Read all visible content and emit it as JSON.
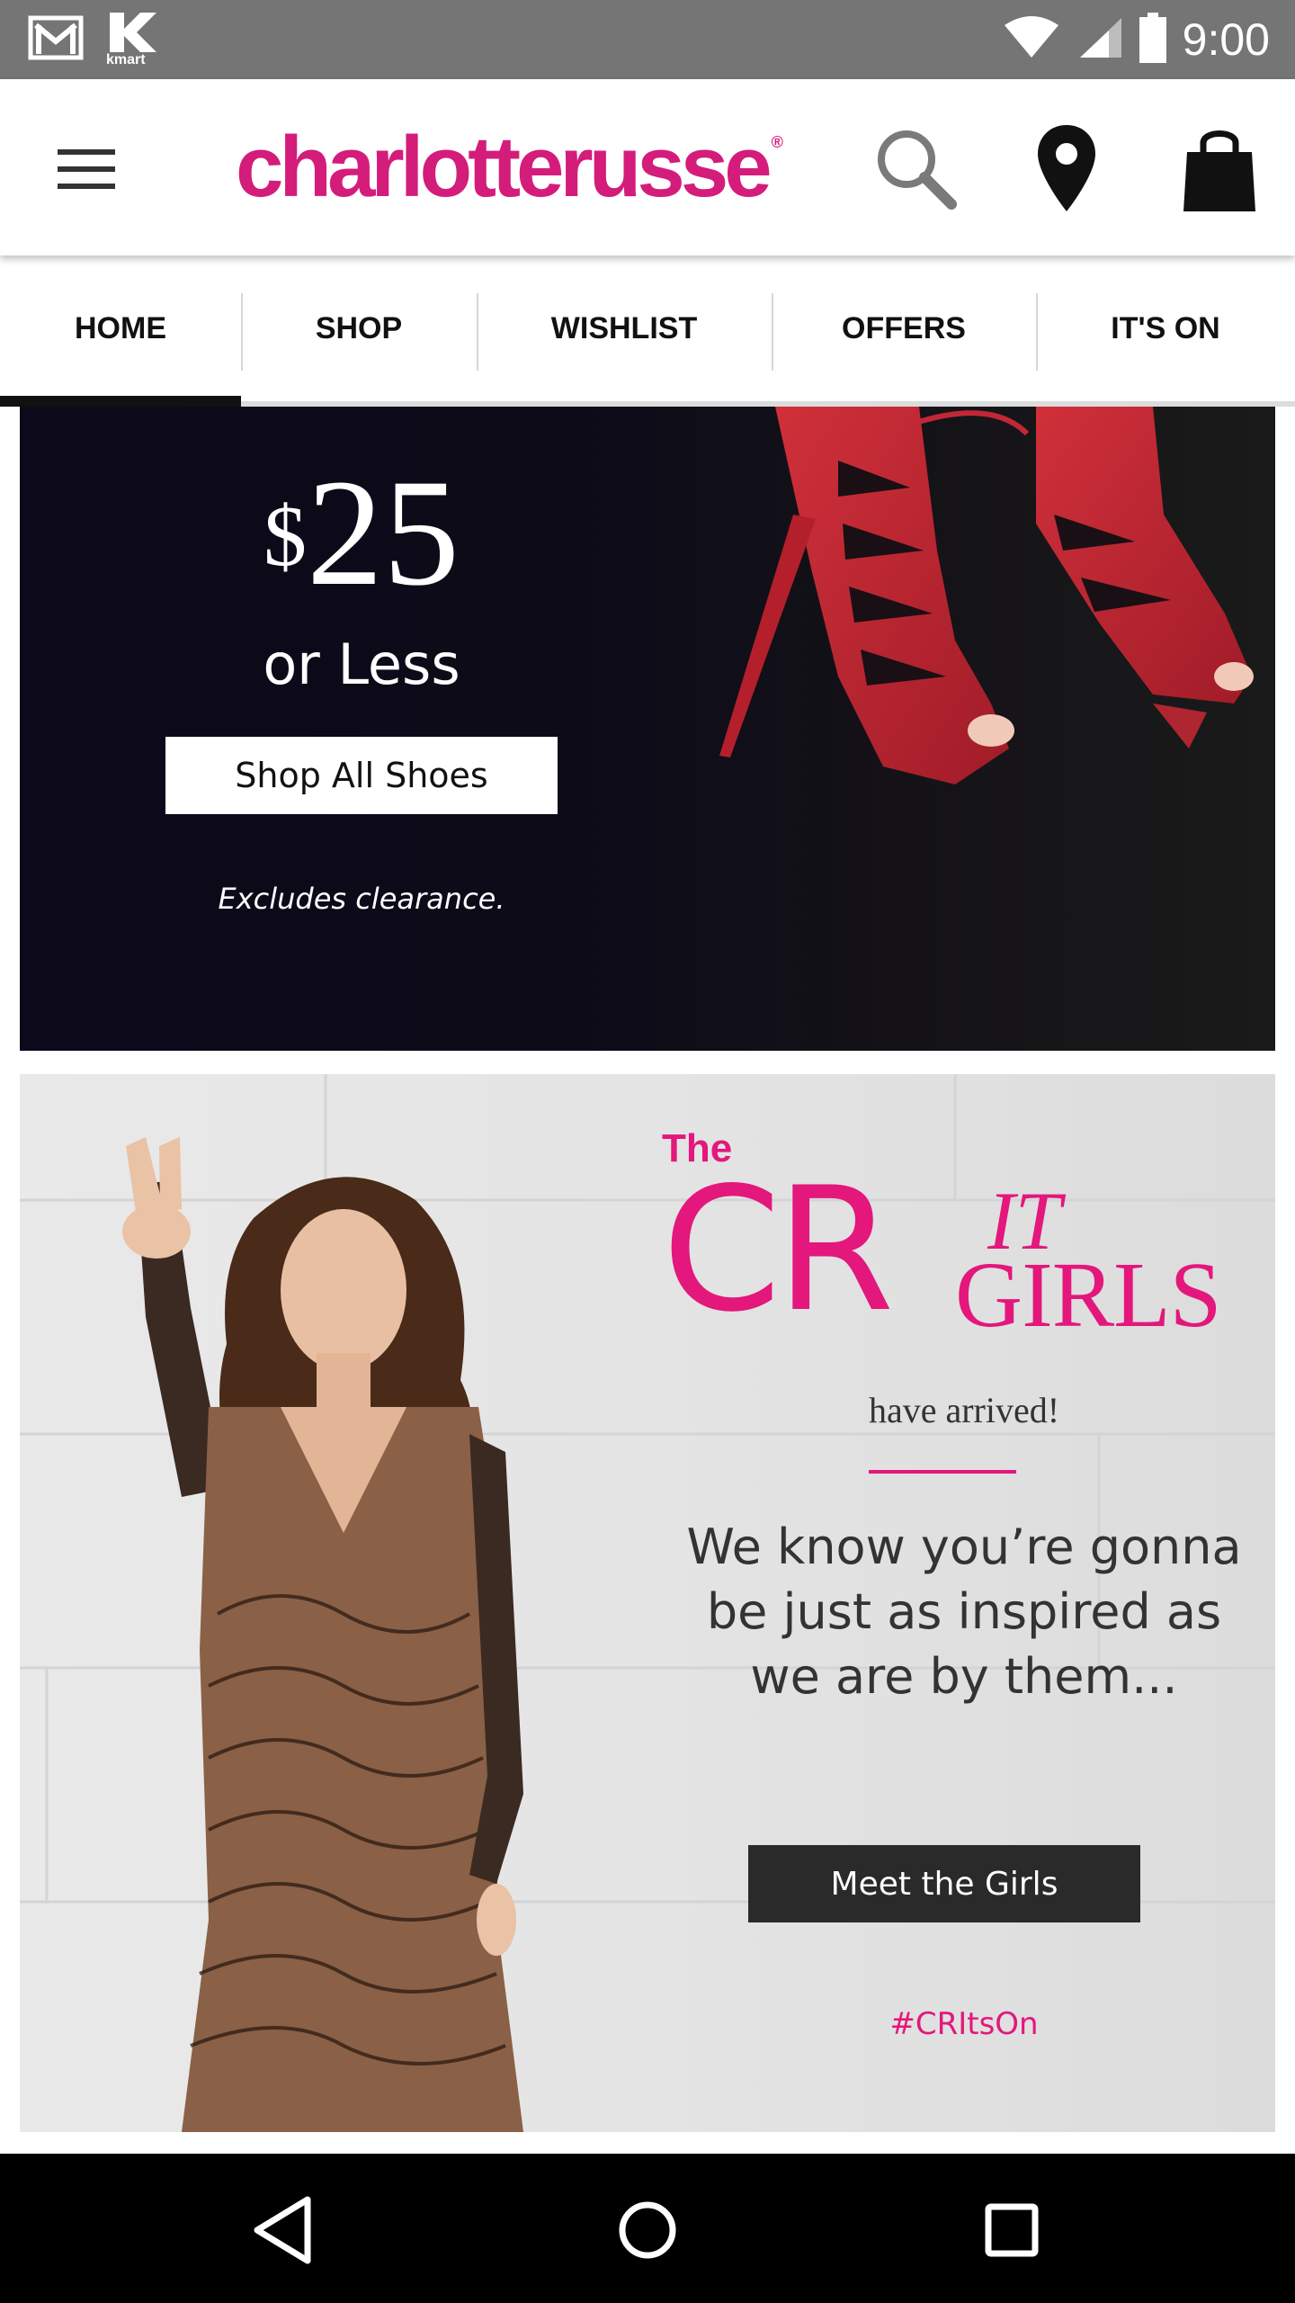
{
  "status_bar": {
    "time": "9:00",
    "left_icons": [
      "gmail-icon",
      "kmart-icon"
    ],
    "kmart_label": "kmart",
    "right_icons": [
      "wifi-icon",
      "signal-icon",
      "battery-icon"
    ]
  },
  "header": {
    "brand": "charlotterusse",
    "brand_mark": "®",
    "brand_color": "#d41c7b",
    "icons": [
      "menu-icon",
      "search-icon",
      "location-pin-icon",
      "shopping-bag-icon"
    ]
  },
  "tabs": [
    {
      "label": "HOME",
      "active": true
    },
    {
      "label": "SHOP",
      "active": false
    },
    {
      "label": "WISHLIST",
      "active": false
    },
    {
      "label": "OFFERS",
      "active": false
    },
    {
      "label": "IT'S ON",
      "active": false
    }
  ],
  "promo_shoes": {
    "currency": "$",
    "amount": "25",
    "subtitle": "or Less",
    "cta": "Shop All Shoes",
    "note": "Excludes clearance."
  },
  "promo_girls": {
    "the": "The",
    "cr": "CR",
    "it": "IT",
    "girls": "GIRLS",
    "arrived": "have arrived!",
    "message": "We know you’re gonna be just as inspired as we are by them...",
    "cta": "Meet the Girls",
    "hashtag": "#CRItsOn",
    "accent_color": "#e3177c"
  },
  "nav_bar": {
    "icons": [
      "back-icon",
      "home-icon",
      "recents-icon"
    ]
  }
}
